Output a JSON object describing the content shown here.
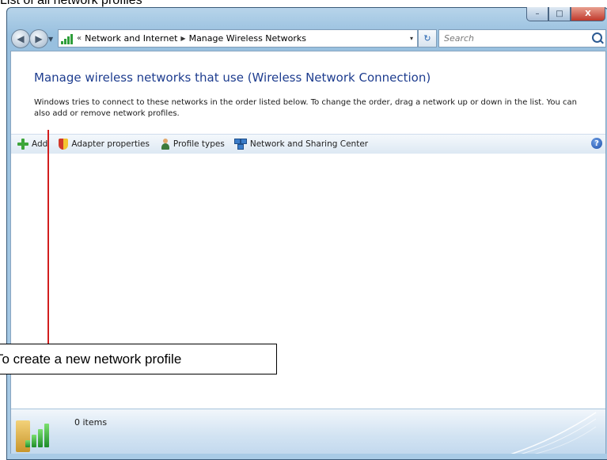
{
  "caption": "List of all network profiles",
  "window": {
    "controls": {
      "minimize_glyph": "–",
      "maximize_glyph": "□",
      "close_glyph": "X"
    }
  },
  "address": {
    "overflow": "«",
    "crumbs": [
      "Network and Internet",
      "Manage Wireless Networks"
    ],
    "separator": "▶",
    "dropdown": "▾",
    "refresh_glyph": "↻"
  },
  "search": {
    "placeholder": "Search"
  },
  "header": {
    "title": "Manage wireless networks that use (Wireless Network Connection)",
    "description": "Windows tries to connect to these networks in the order listed below. To change the order, drag a network up or down in the list. You can also add or remove network profiles."
  },
  "toolbar": {
    "items": [
      {
        "label": "Add",
        "icon": "plus-icon"
      },
      {
        "label": "Adapter properties",
        "icon": "shield-icon"
      },
      {
        "label": "Profile types",
        "icon": "person-icon"
      },
      {
        "label": "Network and Sharing Center",
        "icon": "network-icon"
      }
    ],
    "help_glyph": "?"
  },
  "details": {
    "item_count": "0 items"
  },
  "callout": {
    "text": "To create a new network profile"
  },
  "colors": {
    "title_blue": "#1e3d8f",
    "annotation_red": "#d21e1e",
    "accent_green": "#3da53a"
  }
}
